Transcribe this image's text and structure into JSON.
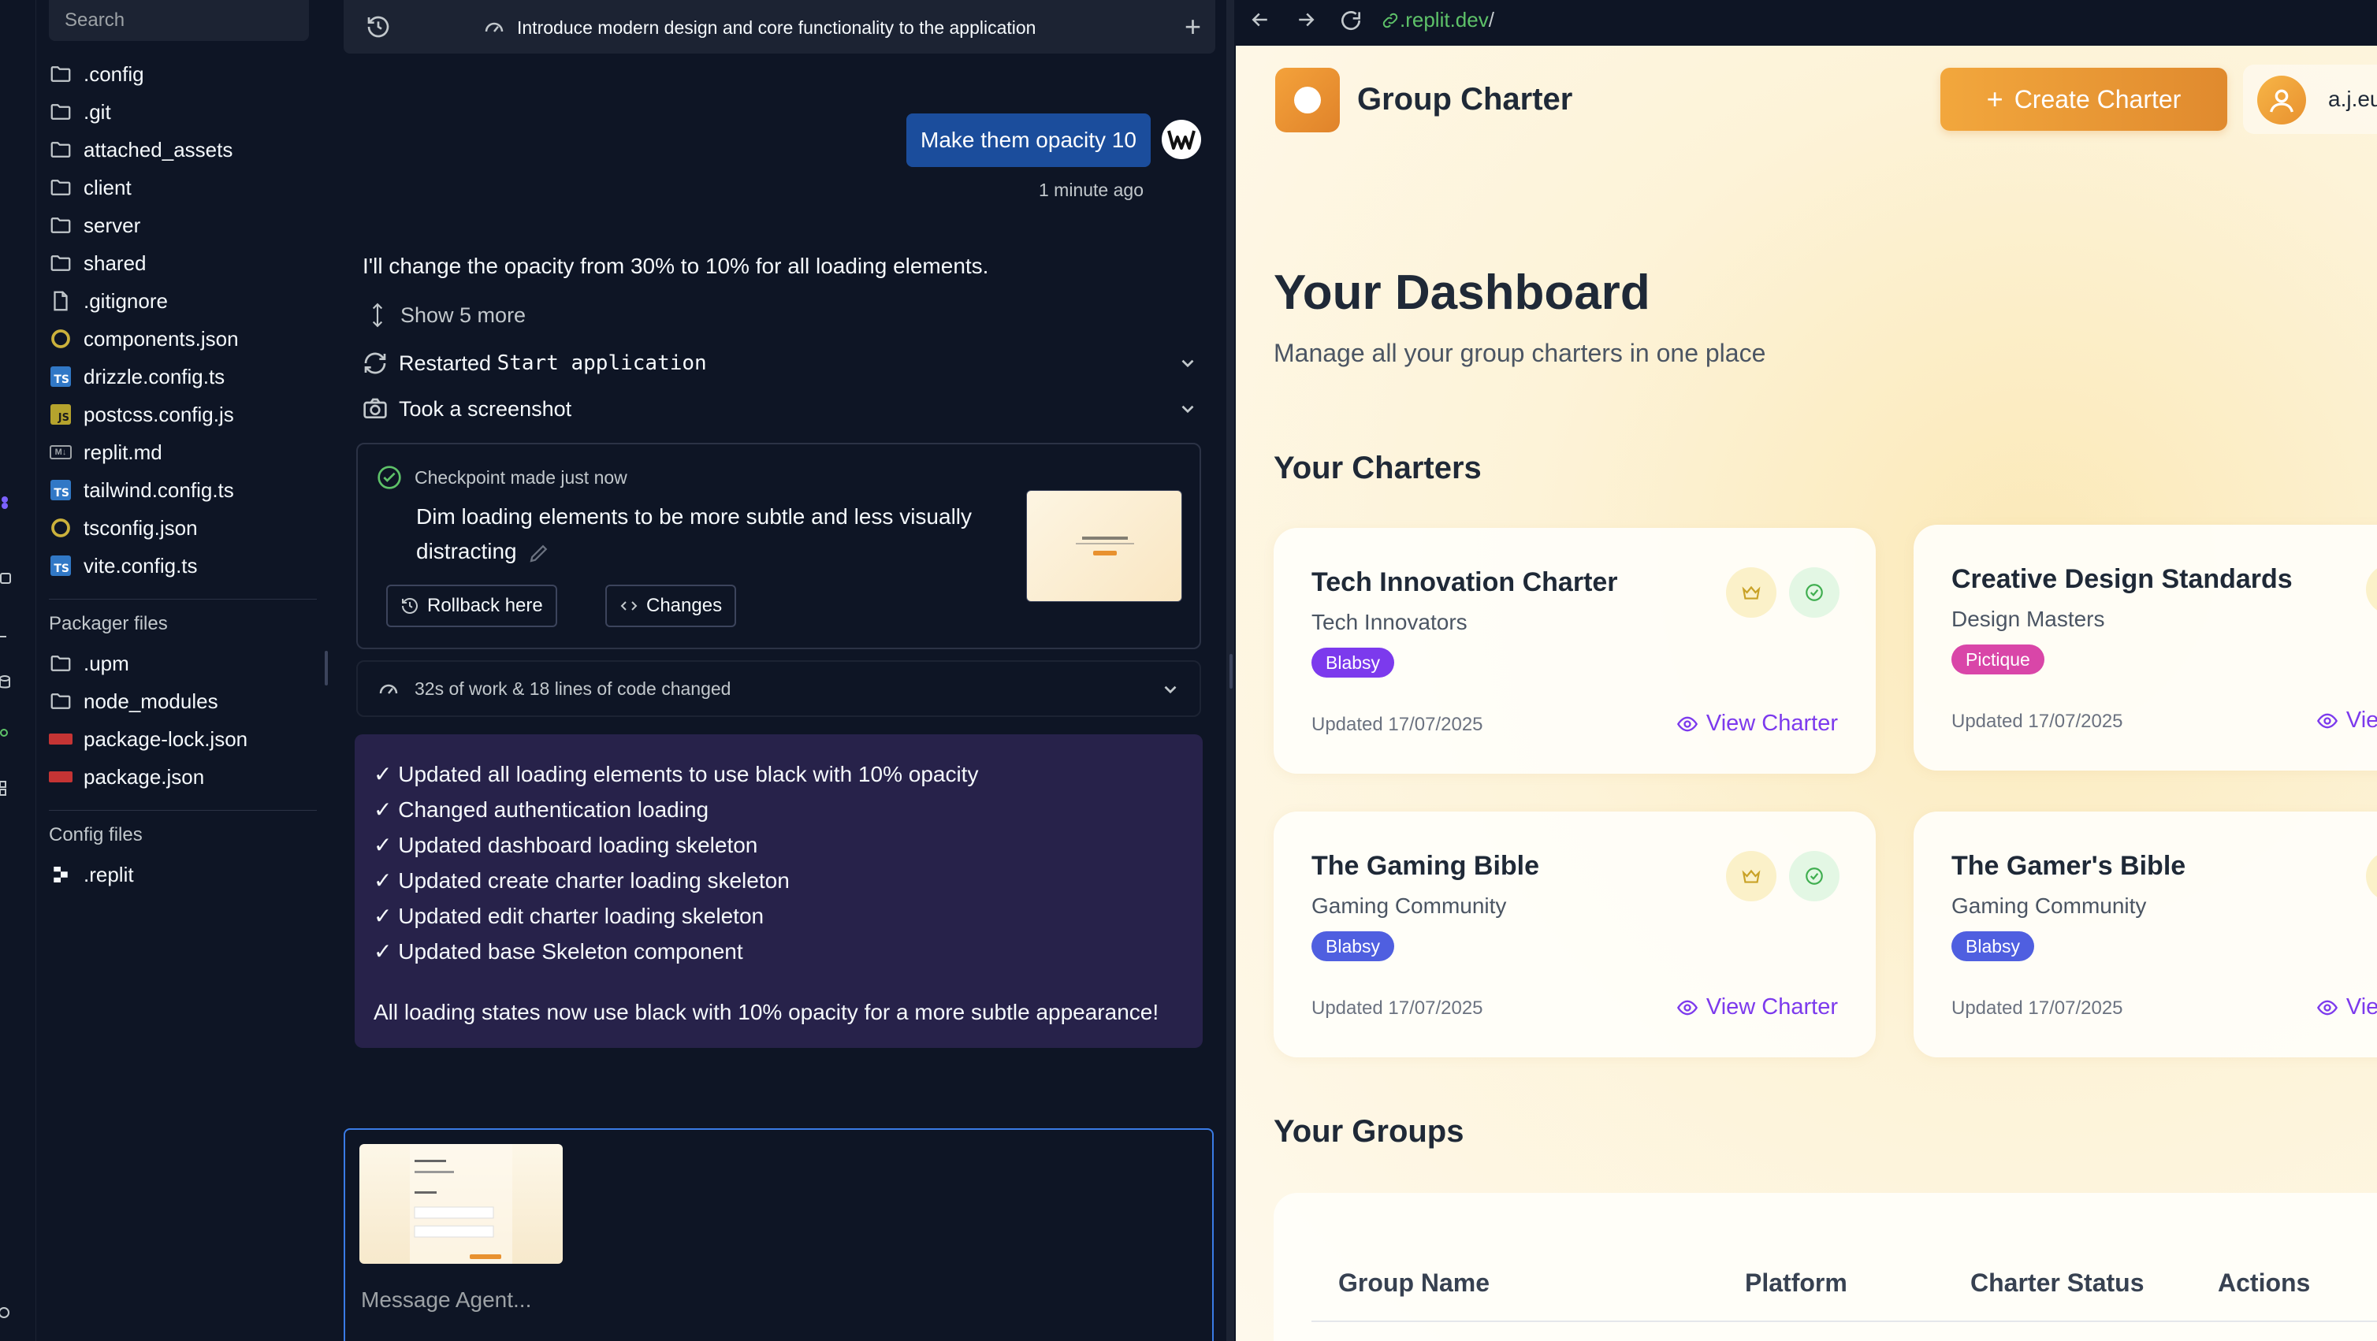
{
  "files": {
    "search_placeholder": "Search",
    "items": [
      {
        "name": ".config",
        "icon": "folder-icon"
      },
      {
        "name": ".git",
        "icon": "folder-icon"
      },
      {
        "name": "attached_assets",
        "icon": "folder-icon"
      },
      {
        "name": "client",
        "icon": "folder-icon"
      },
      {
        "name": "server",
        "icon": "folder-icon"
      },
      {
        "name": "shared",
        "icon": "folder-icon"
      },
      {
        "name": ".gitignore",
        "icon": "file-icon"
      },
      {
        "name": "components.json",
        "icon": "json-icon"
      },
      {
        "name": "drizzle.config.ts",
        "icon": "typescript-icon"
      },
      {
        "name": "postcss.config.js",
        "icon": "javascript-icon"
      },
      {
        "name": "replit.md",
        "icon": "markdown-icon"
      },
      {
        "name": "tailwind.config.ts",
        "icon": "typescript-icon"
      },
      {
        "name": "tsconfig.json",
        "icon": "json-icon"
      },
      {
        "name": "vite.config.ts",
        "icon": "typescript-icon"
      }
    ],
    "packager_title": "Packager files",
    "packager_items": [
      {
        "name": ".upm",
        "icon": "folder-icon"
      },
      {
        "name": "node_modules",
        "icon": "folder-icon"
      },
      {
        "name": "package-lock.json",
        "icon": "npm-icon"
      },
      {
        "name": "package.json",
        "icon": "npm-icon"
      }
    ],
    "config_title": "Config files",
    "config_items": [
      {
        "name": ".replit",
        "icon": "replit-icon"
      }
    ]
  },
  "chat": {
    "header_title": "Introduce modern design and core functionality to the application",
    "user_message": "Make them opacity 10",
    "user_timestamp": "1 minute ago",
    "agent_reply": "I'll change the opacity from 30% to 10% for all loading elements.",
    "show_more": "Show 5 more",
    "action_restart_prefix": "Restarted",
    "action_restart_code": "Start application",
    "action_screenshot": "Took a screenshot",
    "checkpoint": {
      "header": "Checkpoint made just now",
      "description": "Dim loading elements to be more subtle and less visually distracting",
      "rollback_label": "Rollback here",
      "changes_label": "Changes"
    },
    "work_summary": "32s of work & 18 lines of code changed",
    "summary_lines": [
      "✓ Updated all loading elements to use black with 10% opacity",
      "✓ Changed authentication loading",
      "✓ Updated dashboard loading skeleton",
      "✓ Updated create charter loading skeleton",
      "✓ Updated edit charter loading skeleton",
      "✓ Updated base Skeleton component"
    ],
    "summary_final": "All loading states now use black with 10% opacity for a more subtle appearance!",
    "composer_placeholder": "Message Agent..."
  },
  "preview": {
    "url_domain": ".replit.dev",
    "url_path": "/",
    "brand": "Group Charter",
    "create_button": "Create Charter",
    "user_name": "a.j.eu",
    "heading": "Your Dashboard",
    "subheading": "Manage all your group charters in one place",
    "charters_title": "Your Charters",
    "charters": [
      {
        "title": "Tech Innovation Charter",
        "group": "Tech Innovators",
        "tag": "Blabsy",
        "tag_color": "#7c3aed",
        "updated": "Updated 17/07/2025",
        "action": "View Charter"
      },
      {
        "title": "Creative Design Standards",
        "group": "Design Masters",
        "tag": "Pictique",
        "tag_color": "#d946a8",
        "updated": "Updated 17/07/2025",
        "action": "View Charter"
      },
      {
        "title": "The Gaming Bible",
        "group": "Gaming Community",
        "tag": "Blabsy",
        "tag_color": "#4f5fe0",
        "updated": "Updated 17/07/2025",
        "action": "View Charter"
      },
      {
        "title": "The Gamer's Bible",
        "group": "Gaming Community",
        "tag": "Blabsy",
        "tag_color": "#4f5fe0",
        "updated": "Updated 17/07/2025",
        "action": "View Charter"
      }
    ],
    "groups_title": "Your Groups",
    "table_headers": [
      "Group Name",
      "Platform",
      "Charter Status",
      "Actions"
    ]
  }
}
